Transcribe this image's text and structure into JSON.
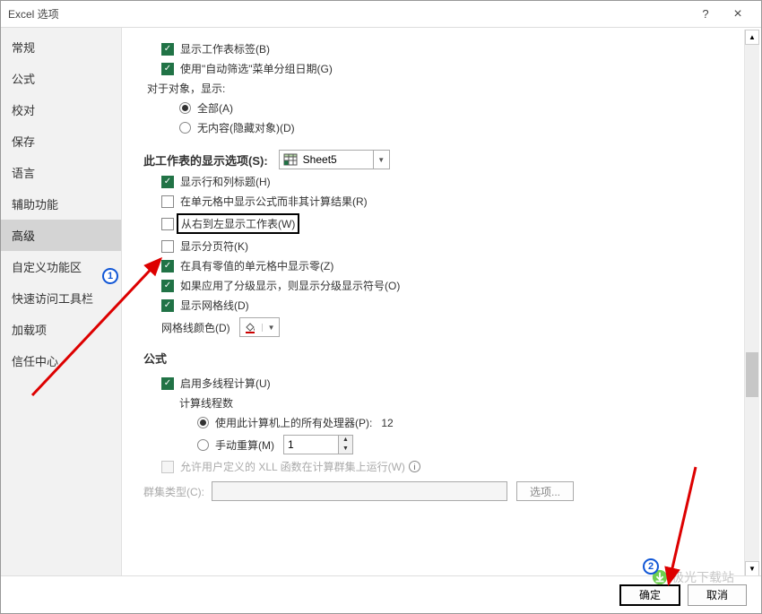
{
  "window": {
    "title": "Excel 选项",
    "help": "?",
    "close": "×"
  },
  "sidebar": {
    "items": [
      {
        "label": "常规"
      },
      {
        "label": "公式"
      },
      {
        "label": "校对"
      },
      {
        "label": "保存"
      },
      {
        "label": "语言"
      },
      {
        "label": "辅助功能"
      },
      {
        "label": "高级"
      },
      {
        "label": "自定义功能区"
      },
      {
        "label": "快速访问工具栏"
      },
      {
        "label": "加载项"
      },
      {
        "label": "信任中心"
      }
    ],
    "active_index": 6
  },
  "top_checks": {
    "show_tabs": "显示工作表标签(B)",
    "use_autofilter": "使用\"自动筛选\"菜单分组日期(G)"
  },
  "objects": {
    "label": "对于对象，显示:",
    "all": "全部(A)",
    "none": "无内容(隐藏对象)(D)"
  },
  "sheet_section": {
    "title": "此工作表的显示选项(S):",
    "sheet_name": "Sheet5",
    "opts": {
      "headers": "显示行和列标题(H)",
      "formulas_in_cells": "在单元格中显示公式而非其计算结果(R)",
      "rtl": "从右到左显示工作表(W)",
      "page_breaks": "显示分页符(K)",
      "zeros": "在具有零值的单元格中显示零(Z)",
      "outline": "如果应用了分级显示，则显示分级显示符号(O)",
      "gridlines": "显示网格线(D)",
      "grid_color_label": "网格线颜色(D)"
    }
  },
  "formulas_section": {
    "title": "公式",
    "multithread": "启用多线程计算(U)",
    "threads_label": "计算线程数",
    "use_all": "使用此计算机上的所有处理器(P):",
    "cpu_count": "12",
    "manual": "手动重算(M)",
    "manual_value": "1",
    "xll": "允许用户定义的 XLL 函数在计算群集上运行(W)",
    "cluster_label": "群集类型(C):",
    "options_btn": "选项..."
  },
  "footer": {
    "ok": "确定",
    "cancel": "取消"
  },
  "annotations": {
    "one": "1",
    "two": "2"
  },
  "watermark": "极光下载站",
  "icons": {
    "triangle_down": "▼",
    "triangle_up": "▲",
    "paint": "🪣"
  }
}
